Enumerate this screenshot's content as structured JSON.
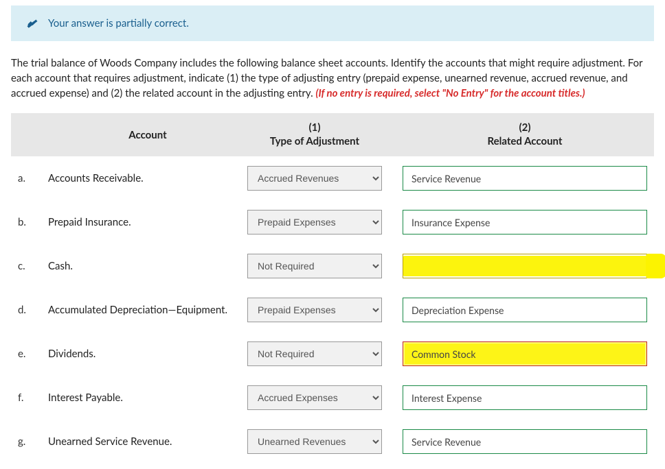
{
  "banner": {
    "text": "Your answer is partially correct."
  },
  "question": {
    "part1": "The trial balance of Woods Company includes the following balance sheet accounts. Identify the accounts that might require adjustment. For each account that requires adjustment, indicate (1) the type of adjusting entry (prepaid expense, unearned revenue, accrued revenue, and accrued expense) and (2) the related account in the adjusting entry. ",
    "emph": "(If no entry is required, select \"No Entry\" for the account titles.)"
  },
  "headers": {
    "account": "Account",
    "col1_top": "(1)",
    "col1_bot": "Type of Adjustment",
    "col2_top": "(2)",
    "col2_bot": "Related Account"
  },
  "type_options": [
    "Accrued Revenues",
    "Prepaid Expenses",
    "Not Required",
    "Accrued Expenses",
    "Unearned Revenues"
  ],
  "rows": {
    "a": {
      "letter": "a.",
      "account": "Accounts Receivable.",
      "type": "Accrued Revenues",
      "related": "Service Revenue",
      "state": "ok"
    },
    "b": {
      "letter": "b.",
      "account": "Prepaid Insurance.",
      "type": "Prepaid Expenses",
      "related": "Insurance Expense",
      "state": "ok"
    },
    "c": {
      "letter": "c.",
      "account": "Cash.",
      "type": "Not Required",
      "related": "",
      "state": "highlight"
    },
    "d": {
      "letter": "d.",
      "account": "Accumulated Depreciation—Equipment.",
      "type": "Prepaid Expenses",
      "related": "Depreciation Expense",
      "state": "ok"
    },
    "e": {
      "letter": "e.",
      "account": "Dividends.",
      "type": "Not Required",
      "related": "Common Stock",
      "state": "error"
    },
    "f": {
      "letter": "f.",
      "account": "Interest Payable.",
      "type": "Accrued Expenses",
      "related": "Interest Expense",
      "state": "ok"
    },
    "g": {
      "letter": "g.",
      "account": "Unearned Service Revenue.",
      "type": "Unearned Revenues",
      "related": "Service Revenue",
      "state": "ok"
    }
  }
}
